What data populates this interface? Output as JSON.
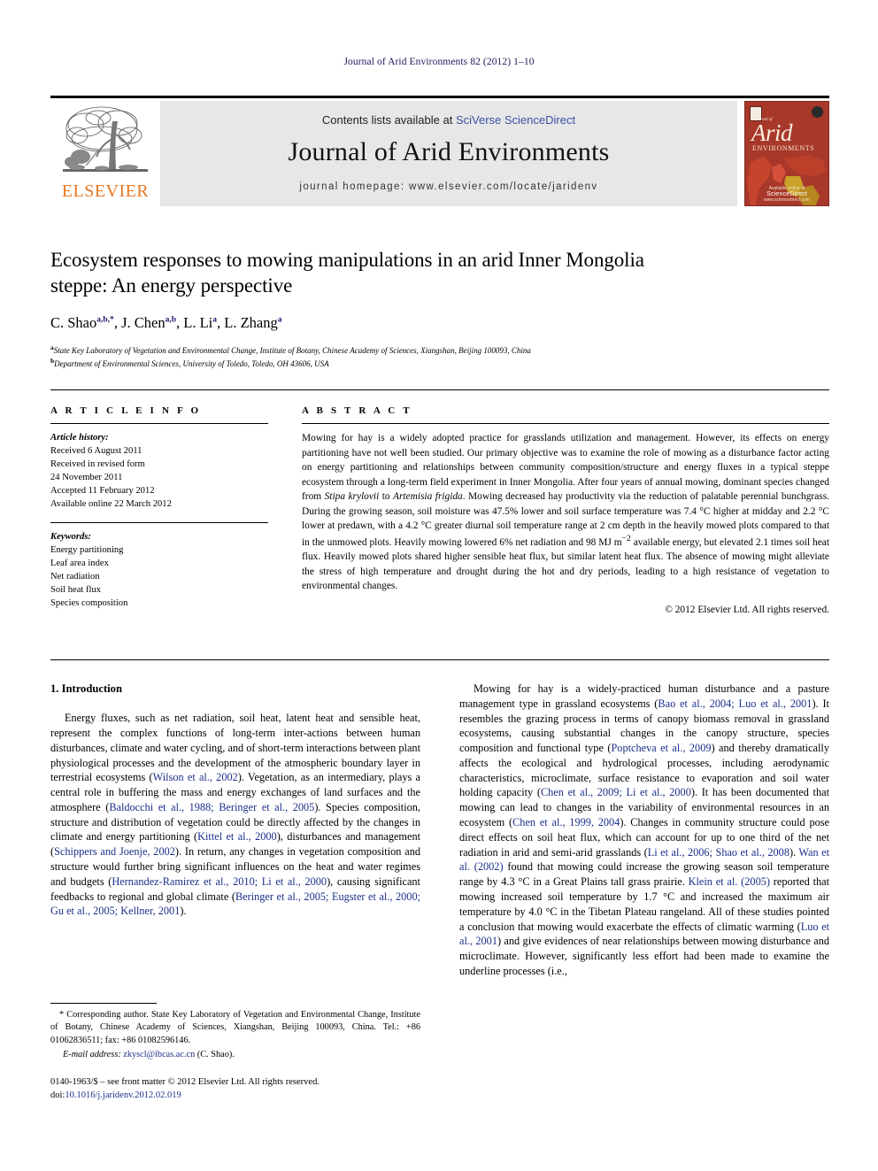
{
  "running_head": "Journal of Arid Environments 82 (2012) 1–10",
  "masthead": {
    "publisher_name": "ELSEVIER",
    "contents_prefix": "Contents lists available at ",
    "contents_link": "SciVerse ScienceDirect",
    "journal_title": "Journal of Arid Environments",
    "homepage": "journal homepage: www.elsevier.com/locate/jaridenv",
    "cover": {
      "journal_of": "Journal of",
      "arid": "Arid",
      "environments": "ENVIRONMENTS",
      "footer_small": "Available online at",
      "footer_brand": "ScienceDirect",
      "footer_url": "www.sciencedirect.com"
    }
  },
  "article": {
    "title": "Ecosystem responses to mowing manipulations in an arid Inner Mongolia steppe: An energy perspective",
    "authors_html": "C. Shao<sup>a,b,*</sup>, J. Chen<sup>a,b</sup>, L. Li<sup>a</sup>, L. Zhang<sup>a</sup>",
    "affiliations": [
      {
        "marker": "a",
        "text": "State Key Laboratory of Vegetation and Environmental Change, Institute of Botany, Chinese Academy of Sciences, Xiangshan, Beijing 100093, China"
      },
      {
        "marker": "b",
        "text": "Department of Environmental Sciences, University of Toledo, Toledo, OH 43606, USA"
      }
    ]
  },
  "article_info": {
    "heading": "A R T I C L E   I N F O",
    "history_label": "Article history:",
    "history": [
      "Received 6 August 2011",
      "Received in revised form",
      "24 November 2011",
      "Accepted 11 February 2012",
      "Available online 22 March 2012"
    ],
    "keywords_label": "Keywords:",
    "keywords": [
      "Energy partitioning",
      "Leaf area index",
      "Net radiation",
      "Soil heat flux",
      "Species composition"
    ]
  },
  "abstract": {
    "heading": "A B S T R A C T",
    "body_html": "Mowing for hay is a widely adopted practice for grasslands utilization and management. However, its effects on energy partitioning have not well been studied. Our primary objective was to examine the role of mowing as a disturbance factor acting on energy partitioning and relationships between community composition/structure and energy fluxes in a typical steppe ecosystem through a long-term field experiment in Inner Mongolia. After four years of annual mowing, dominant species changed from <i>Stipa krylovii</i> to <i>Artemisia frigida</i>. Mowing decreased hay productivity via the reduction of palatable perennial bunchgrass. During the growing season, soil moisture was 47.5% lower and soil surface temperature was 7.4 &#176;C higher at midday and 2.2 &#176;C lower at predawn, with a 4.2 &#176;C greater diurnal soil temperature range at 2 cm depth in the heavily mowed plots compared to that in the unmowed plots. Heavily mowing lowered 6% net radiation and 98 MJ m<sup>&#8722;2</sup> available energy, but elevated 2.1 times soil heat flux. Heavily mowed plots shared higher sensible heat flux, but similar latent heat flux. The absence of mowing might alleviate the stress of high temperature and drought during the hot and dry periods, leading to a high resistance of vegetation to environmental changes.",
    "copyright": "© 2012 Elsevier Ltd. All rights reserved."
  },
  "introduction": {
    "heading": "1.  Introduction",
    "left_paragraph_html": "Energy fluxes, such as net radiation, soil heat, latent heat and sensible heat, represent the complex functions of long-term inter-actions between human disturbances, climate and water cycling, and of short-term interactions between plant physiological processes and the development of the atmospheric boundary layer in terrestrial ecosystems (<span class=\"cite\">Wilson et al., 2002</span>). Vegetation, as an intermediary, plays a central role in buffering the mass and energy exchanges of land surfaces and the atmosphere (<span class=\"cite\">Baldocchi et al., 1988; Beringer et al., 2005</span>). Species composition, structure and distribution of vegetation could be directly affected by the changes in climate and energy partitioning (<span class=\"cite\">Kittel et al., 2000</span>), disturbances and management (<span class=\"cite\">Schippers and Joenje, 2002</span>). In return, any changes in vegetation composition and structure would further bring significant influences on the heat and water regimes and budgets (<span class=\"cite\">Hernandez-Ramirez et al., 2010; Li et al., 2000</span>), causing significant feedbacks to regional and global climate (<span class=\"cite\">Beringer et al., 2005; Eugster et al., 2000; Gu et al., 2005; Kellner, 2001</span>).",
    "right_paragraph_html": "Mowing for hay is a widely-practiced human disturbance and a pasture management type in grassland ecosystems (<span class=\"cite\">Bao et al., 2004; Luo et al., 2001</span>). It resembles the grazing process in terms of canopy biomass removal in grassland ecosystems, causing substantial changes in the canopy structure, species composition and functional type (<span class=\"cite\">Poptcheva et al., 2009</span>) and thereby dramatically affects the ecological and hydrological processes, including aerodynamic characteristics, microclimate, surface resistance to evaporation and soil water holding capacity (<span class=\"cite\">Chen et al., 2009; Li et al., 2000</span>). It has been documented that mowing can lead to changes in the variability of environmental resources in an ecosystem (<span class=\"cite\">Chen et al., 1999, 2004</span>). Changes in community structure could pose direct effects on soil heat flux, which can account for up to one third of the net radiation in arid and semi-arid grasslands (<span class=\"cite\">Li et al., 2006; Shao et al., 2008</span>). <span class=\"cite\">Wan et al. (2002)</span> found that mowing could increase the growing season soil temperature range by 4.3 &#176;C in a Great Plains tall grass prairie. <span class=\"cite\">Klein et al. (2005)</span> reported that mowing increased soil temperature by 1.7 &#176;C and increased the maximum air temperature by 4.0 &#176;C in the Tibetan Plateau rangeland. All of these studies pointed a conclusion that mowing would exacerbate the effects of climatic warming (<span class=\"cite\">Luo et al., 2001</span>) and give evidences of near relationships between mowing disturbance and microclimate. However, significantly less effort had been made to examine the underline processes (i.e.,"
  },
  "footnotes": {
    "corresponding_html": "* Corresponding author. State Key Laboratory of Vegetation and Environmental Change, Institute of Botany, Chinese Academy of Sciences, Xiangshan, Beijing 100093, China. Tel.: +86 01062836511; fax: +86 01082596146.",
    "email_label": "E-mail address:",
    "email_address": "zkyscl@ibcas.ac.cn",
    "email_owner": "(C. Shao)."
  },
  "imprint": {
    "line1": "0140-1963/$ – see front matter © 2012 Elsevier Ltd. All rights reserved.",
    "doi_label": "doi:",
    "doi_value": "10.1016/j.jaridenv.2012.02.019"
  },
  "colors": {
    "link_blue": "#3a52a4",
    "cite_blue": "#1b2f8a",
    "elsevier_orange": "#E87722",
    "cover_red": "#a8382a",
    "masthead_grey": "#e7e7e7"
  }
}
